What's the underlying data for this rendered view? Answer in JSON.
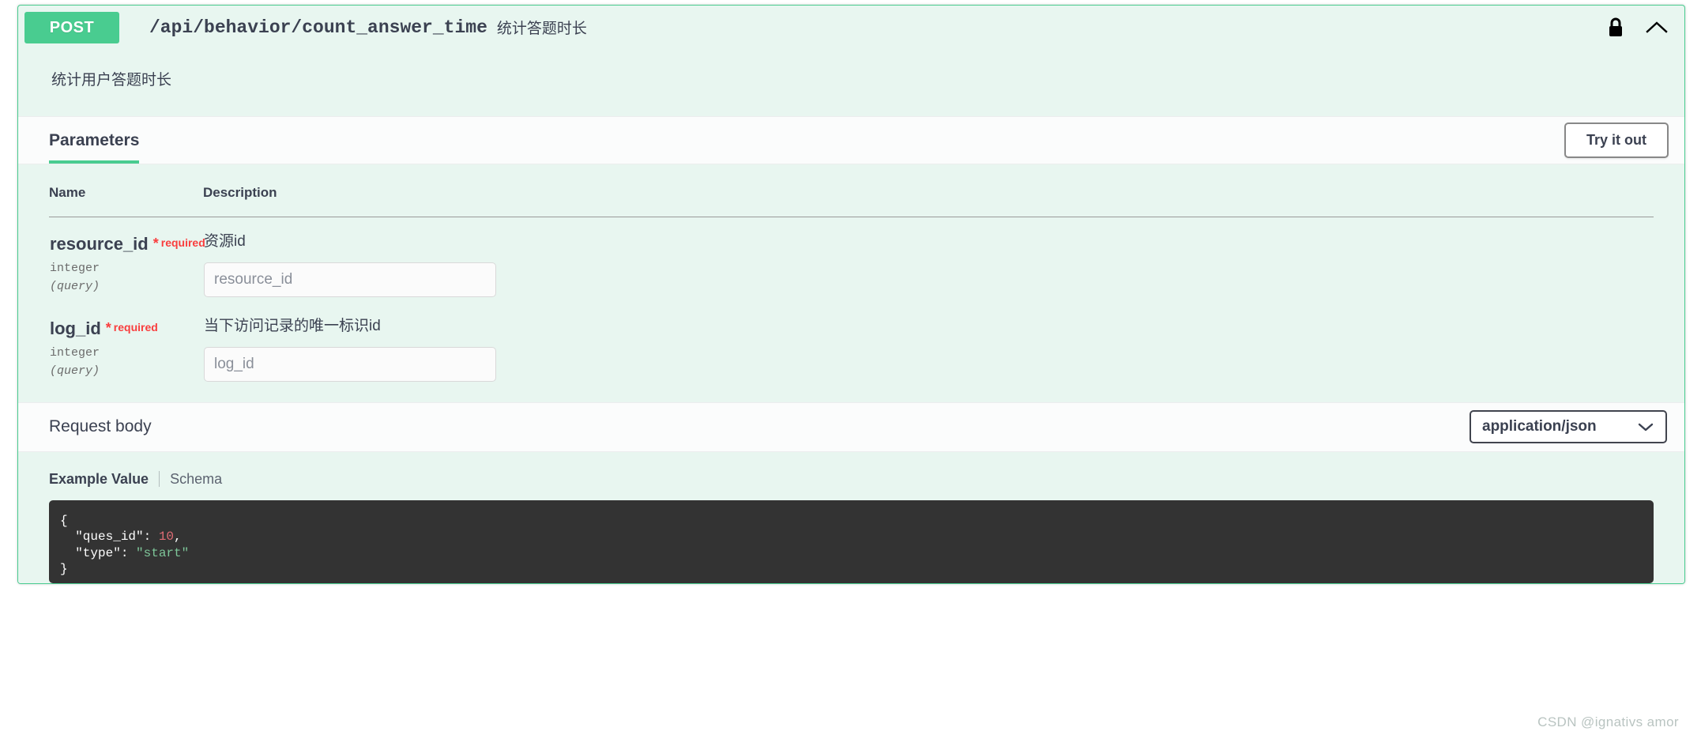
{
  "operation": {
    "method": "POST",
    "path": "/api/behavior/count_answer_time",
    "summary": "统计答题时长",
    "description": "统计用户答题时长",
    "lock_icon": "lock-closed-icon",
    "collapse_icon": "chevron-up-icon",
    "accent_color": "#49cc90",
    "block_bg": "#e8f6f0"
  },
  "parameters_section": {
    "title": "Parameters",
    "try_it_out_label": "Try it out",
    "columns": {
      "name": "Name",
      "description": "Description"
    },
    "rows": [
      {
        "name": "resource_id",
        "required_star": "*",
        "required_label": "required",
        "type": "integer",
        "in": "(query)",
        "description": "资源id",
        "input_placeholder": "resource_id",
        "input_value": ""
      },
      {
        "name": "log_id",
        "required_star": "*",
        "required_label": "required",
        "type": "integer",
        "in": "(query)",
        "description": "当下访问记录的唯一标识id",
        "input_placeholder": "log_id",
        "input_value": ""
      }
    ]
  },
  "request_body": {
    "label": "Request body",
    "content_type": "application/json",
    "dropdown_icon": "chevron-down-icon",
    "tabs": {
      "example_value": "Example Value",
      "schema": "Schema"
    },
    "example_code": {
      "open_brace": "{",
      "lines": [
        {
          "key": "\"ques_id\"",
          "sep": ": ",
          "value": "10",
          "value_type": "num",
          "trailing": ","
        },
        {
          "key": "\"type\"",
          "sep": ": ",
          "value": "\"start\"",
          "value_type": "str",
          "trailing": ""
        }
      ],
      "close_brace": "}"
    }
  },
  "watermark": "CSDN @ignativs  amor"
}
